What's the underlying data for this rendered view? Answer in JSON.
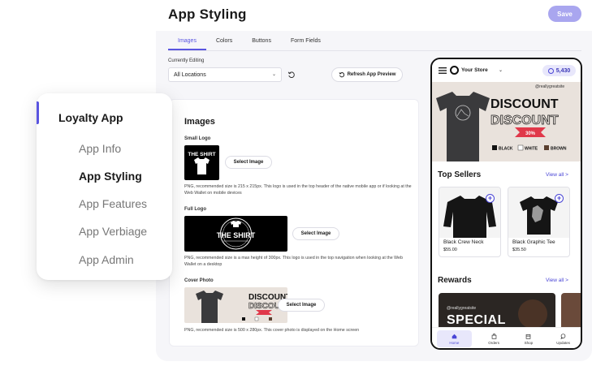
{
  "header": {
    "title": "App Styling",
    "save_label": "Save"
  },
  "tabs": [
    {
      "label": "Images",
      "active": true
    },
    {
      "label": "Colors",
      "active": false
    },
    {
      "label": "Buttons",
      "active": false
    },
    {
      "label": "Form Fields",
      "active": false
    }
  ],
  "editing": {
    "label": "Currently Editing",
    "value": "All Locations",
    "refresh_preview_label": "Refresh App Preview"
  },
  "images": {
    "title": "Images",
    "select_label": "Select Image",
    "small_logo": {
      "label": "Small Logo",
      "desc": "PNG, recommended size is 215 x 215px. This logo is used in the top header of the native mobile app or if looking at the Web Wallet on mobile devices"
    },
    "full_logo": {
      "label": "Full Logo",
      "desc": "PNG, recommended size is a max height of 300px. This logo is used in the top navigation when looking at the Web Wallet on a desktop"
    },
    "cover_photo": {
      "label": "Cover Photo",
      "desc": "PNG, recommended size is 500 x 280px. This cover photo is displayed on the Home screen"
    }
  },
  "logo_text": {
    "line1": "THE SHIRT",
    "line2": "THE SHIRT"
  },
  "cover": {
    "handle": "@reallygreatsite",
    "discount": "DISCOUNT",
    "discount_outline": "DISCOUNT",
    "percent": "30%",
    "colors": [
      "BLACK",
      "WHITE",
      "BROWN"
    ]
  },
  "phone": {
    "store_name": "Your Store",
    "points": "5,430",
    "top_sellers_title": "Top Sellers",
    "view_all": "View all >",
    "products": [
      {
        "name": "Black Crew Neck",
        "price": "$55.00"
      },
      {
        "name": "Black Graphic Tee",
        "price": "$35.50"
      }
    ],
    "rewards_title": "Rewards",
    "reward_handle": "@reallygreatsite",
    "reward_text": "SPECIAL",
    "nav": [
      {
        "label": "Home",
        "icon": "home-icon",
        "active": true
      },
      {
        "label": "Orders",
        "icon": "bag-icon",
        "active": false
      },
      {
        "label": "Shop",
        "icon": "store-icon",
        "active": false
      },
      {
        "label": "Updates",
        "icon": "chat-icon",
        "active": false
      }
    ]
  },
  "sidebar": {
    "heading": "Loyalty App",
    "items": [
      {
        "label": "App Info",
        "current": false
      },
      {
        "label": "App Styling",
        "current": true
      },
      {
        "label": "App Features",
        "current": false
      },
      {
        "label": "App Verbiage",
        "current": false
      },
      {
        "label": "App Admin",
        "current": false
      }
    ]
  },
  "colors": {
    "accent": "#5a55e0",
    "save": "#a9a6ef",
    "link": "#4a46d6"
  }
}
